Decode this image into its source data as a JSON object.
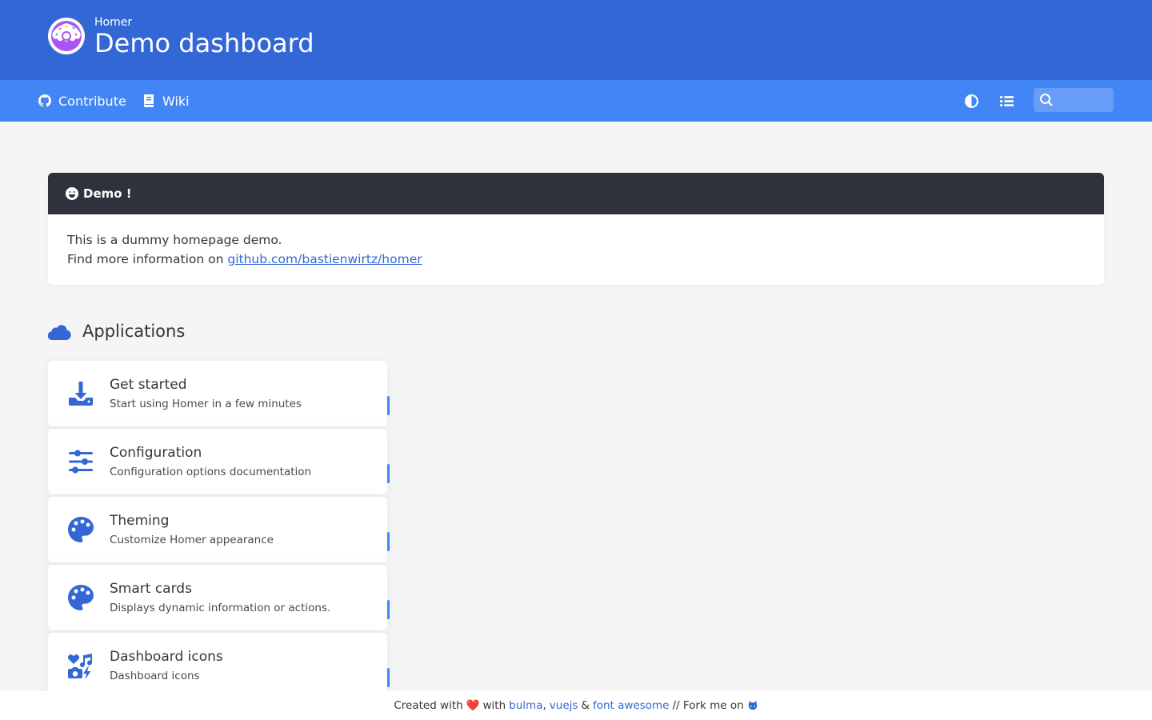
{
  "header": {
    "subtitle": "Homer",
    "title": "Demo dashboard",
    "logo_icon": "donut-icon"
  },
  "navbar": {
    "links": [
      {
        "label": "Contribute",
        "icon": "github-icon"
      },
      {
        "label": "Wiki",
        "icon": "book-icon"
      }
    ],
    "theme_toggle_icon": "contrast-icon",
    "layout_toggle_icon": "list-icon",
    "search": {
      "placeholder": "",
      "value": "",
      "icon": "search-icon"
    }
  },
  "message": {
    "title": "Demo !",
    "icon": "smile-icon",
    "line1": "This is a dummy homepage demo.",
    "line2_prefix": "Find more information on",
    "link_text": "github.com/bastienwirtz/homer"
  },
  "group": {
    "name": "Applications",
    "icon": "cloud-icon",
    "items": [
      {
        "name": "Get started",
        "subtitle": "Start using Homer in a few minutes",
        "icon": "download-icon"
      },
      {
        "name": "Configuration",
        "subtitle": "Configuration options documentation",
        "icon": "sliders-icon"
      },
      {
        "name": "Theming",
        "subtitle": "Customize Homer appearance",
        "icon": "palette-icon"
      },
      {
        "name": "Smart cards",
        "subtitle": "Displays dynamic information or actions.",
        "icon": "palette-icon"
      },
      {
        "name": "Dashboard icons",
        "subtitle": "Dashboard icons",
        "icon": "icons-icon"
      }
    ]
  },
  "footer": {
    "created_with": "Created with",
    "heart": "❤️",
    "with": "with",
    "bulma": "bulma",
    "comma": ",",
    "vuejs": "vuejs",
    "amp": "&",
    "font_awesome": "font awesome",
    "fork_me": "// Fork me on",
    "fork_icon": "github-alt-icon"
  },
  "colors": {
    "header_bg": "#3367d6",
    "navbar_bg": "#4285f4",
    "message_header_bg": "#2f323c",
    "accent": "#3367d6",
    "page_bg": "#f5f5f5"
  }
}
